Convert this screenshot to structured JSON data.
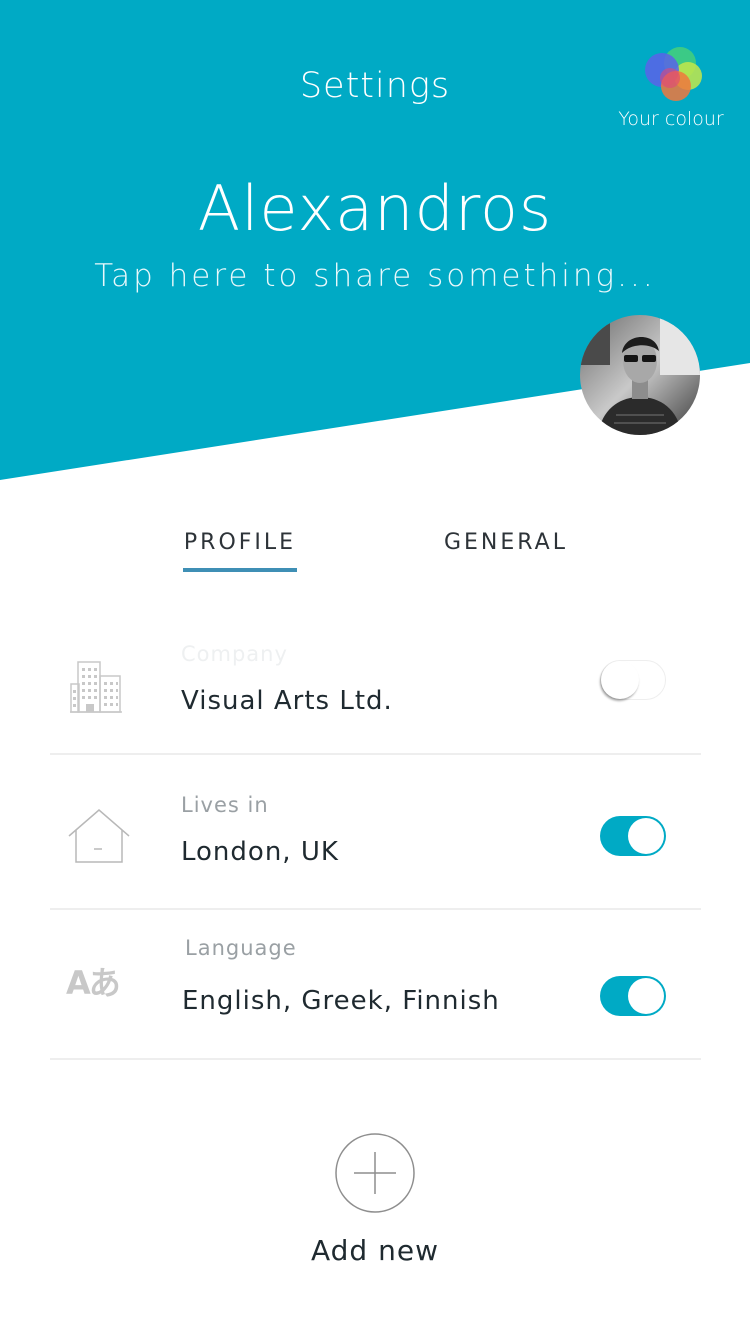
{
  "header": {
    "title": "Settings",
    "colour_picker_label": "Your colour",
    "name": "Alexandros",
    "status_placeholder": "Tap here to share something..."
  },
  "tabs": [
    {
      "label": "PROFILE",
      "active": true
    },
    {
      "label": "GENERAL",
      "active": false
    }
  ],
  "profile_rows": [
    {
      "icon": "building-icon",
      "label": "Company",
      "value": "Visual Arts Ltd.",
      "toggle_on": false
    },
    {
      "icon": "house-icon",
      "label": "Lives in",
      "value": "London, UK",
      "toggle_on": true
    },
    {
      "icon": "language-icon",
      "icon_text": "Aあ",
      "label": "Language",
      "value": "English, Greek, Finnish",
      "toggle_on": true
    }
  ],
  "add_new": {
    "icon": "plus-circle-icon",
    "label": "Add new"
  },
  "colors": {
    "accent": "#00aac5",
    "tab_underline": "#3f8fb5",
    "text_primary": "#1f2a30",
    "text_muted": "#9aa0a4",
    "divider": "#eeeeee"
  }
}
